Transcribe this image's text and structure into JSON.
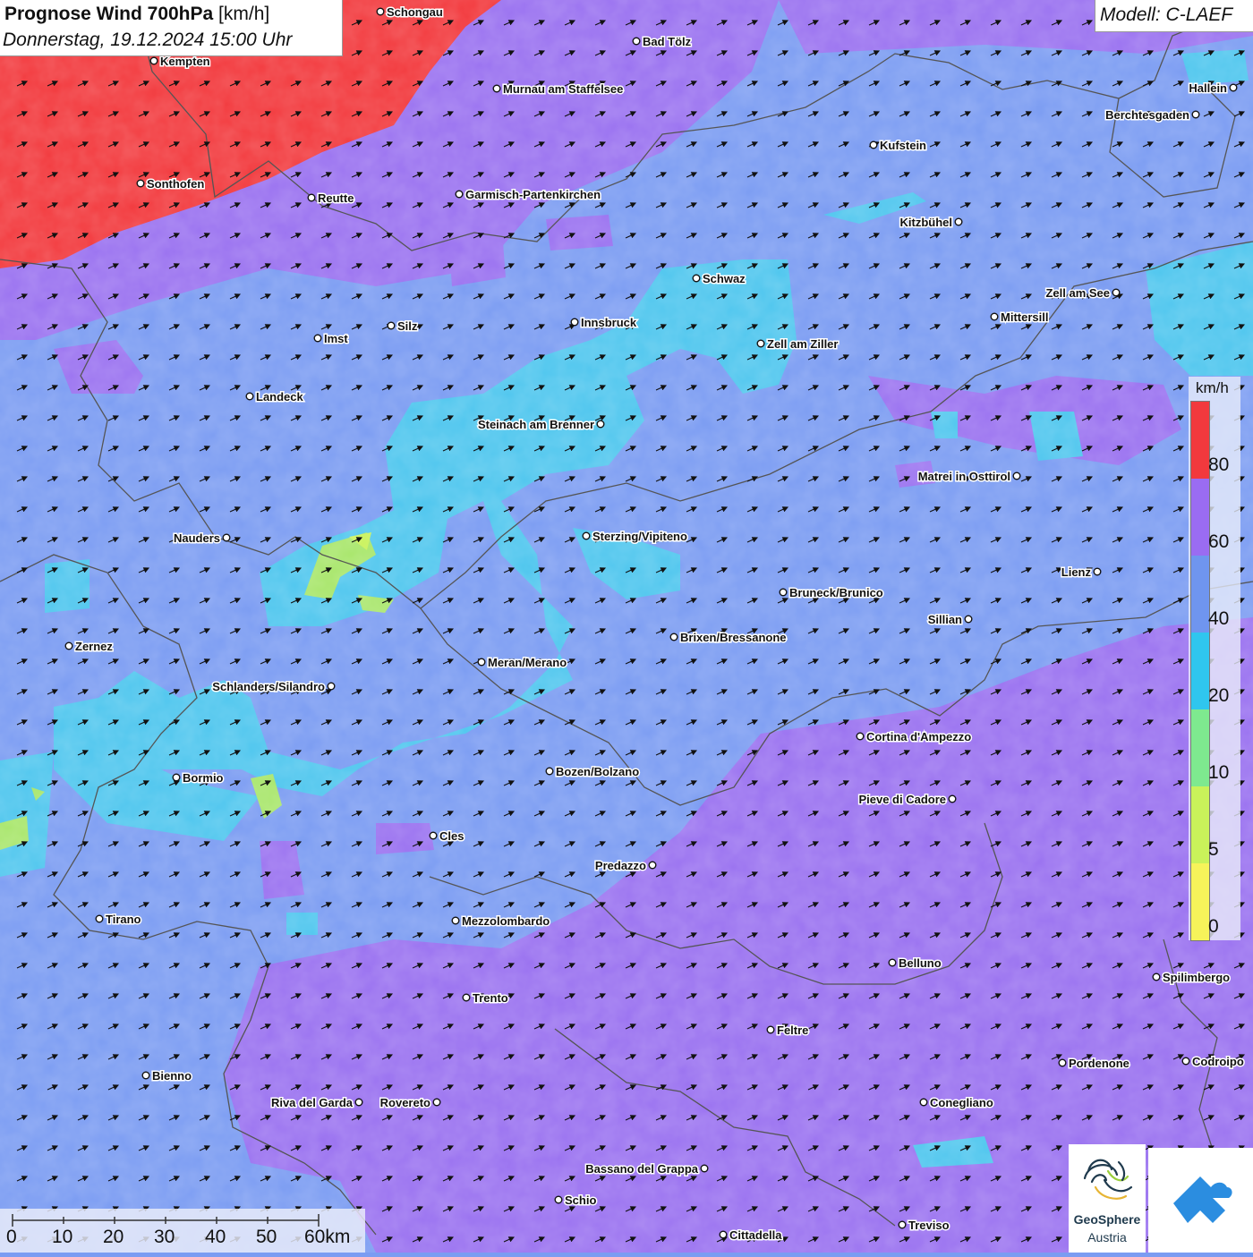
{
  "title": {
    "main": "Prognose Wind 700hPa",
    "unit": "[km/h]",
    "datetime": "Donnerstag, 19.12.2024 15:00 Uhr"
  },
  "model_label": "Modell: C-LAEF",
  "legend": {
    "unit": "km/h",
    "classes": [
      {
        "label": "80",
        "color": "#f2393d"
      },
      {
        "label": "60",
        "color": "#9a6cf2"
      },
      {
        "label": "40",
        "color": "#6f95ef"
      },
      {
        "label": "20",
        "color": "#2fc6ee"
      },
      {
        "label": "10",
        "color": "#7ee98f"
      },
      {
        "label": "5",
        "color": "#c9f25a"
      },
      {
        "label": "0",
        "color": "#f6f35a"
      }
    ]
  },
  "scalebar": {
    "labels": [
      "0",
      "10",
      "20",
      "30",
      "40",
      "50",
      "60km"
    ]
  },
  "places": [
    "Schongau",
    "Bad Tölz",
    "Kempten",
    "Murnau am Staffelsee",
    "Hallein",
    "Berchtesgaden",
    "Kufstein",
    "Sonthofen",
    "Reutte",
    "Garmisch-Partenkirchen",
    "Kitzbühel",
    "Schwaz",
    "Zell am See",
    "Mittersill",
    "Innsbruck",
    "Silz",
    "Imst",
    "Zell am Ziller",
    "Landeck",
    "Steinach am Brenner",
    "Matrei in Osttirol",
    "Nauders",
    "Sterzing/Vipiteno",
    "Lienz",
    "Bruneck/Brunico",
    "Sillian",
    "Zernez",
    "Brixen/Bressanone",
    "Meran/Merano",
    "Schlanders/Silandro",
    "Cortina d'Ampezzo",
    "Bozen/Bolzano",
    "Bormio",
    "Pieve di Cadore",
    "Cles",
    "Predazzo",
    "Tirano",
    "Mezzolombardo",
    "Belluno",
    "Spilimbergo",
    "Trento",
    "Feltre",
    "Pordenone",
    "Codroipo",
    "Bienno",
    "Riva del Garda",
    "Rovereto",
    "Conegliano",
    "Bassano del Grappa",
    "Schio",
    "Treviso",
    "Cittadella"
  ],
  "logo": {
    "name": "GeoSphere",
    "country": "Austria"
  },
  "colors": {
    "wind_80_plus": "#f2393d",
    "wind_60_80": "#9a6cf2",
    "wind_40_60": "#6f95ef",
    "wind_20_40": "#2fc6ee",
    "wind_10_20": "#7ee98f",
    "wind_5_10": "#c9f25a",
    "wind_arrow": "#111111",
    "border_line": "#555555"
  }
}
